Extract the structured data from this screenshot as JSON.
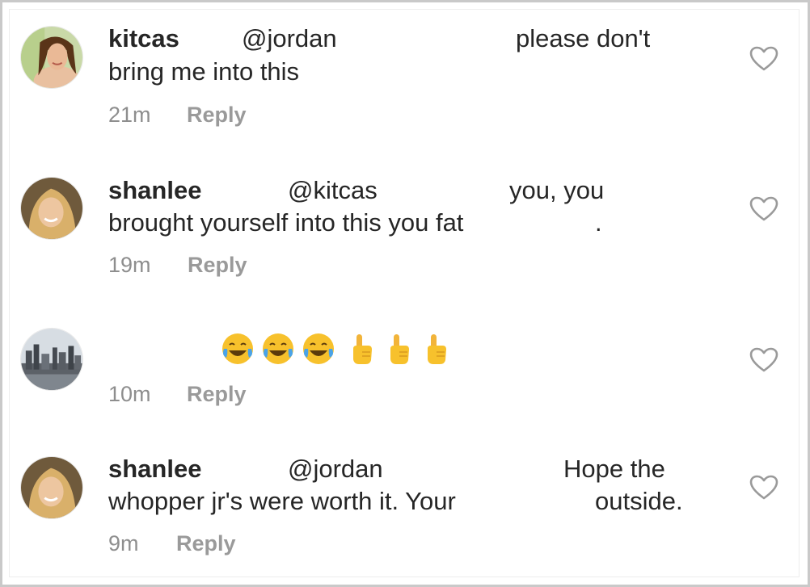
{
  "comments": [
    {
      "username": "kitcas",
      "mention": "@jordan",
      "text_line1_end": "please don't",
      "text_line2": "bring me into this",
      "time": "21m",
      "reply_label": "Reply",
      "avatar_icon": "profile-photo",
      "like_icon": "heart-outline"
    },
    {
      "username": "shanlee",
      "mention": "@kitcas",
      "text_line1_end": "you, you",
      "text_line2": "brought yourself into this you fat",
      "text_line2_end": ".",
      "time": "19m",
      "reply_label": "Reply",
      "avatar_icon": "profile-photo",
      "like_icon": "heart-outline"
    },
    {
      "emojis": [
        "face-with-tears-of-joy",
        "face-with-tears-of-joy",
        "face-with-tears-of-joy",
        "backhand-index-pointing-up",
        "backhand-index-pointing-up",
        "backhand-index-pointing-up"
      ],
      "time": "10m",
      "reply_label": "Reply",
      "avatar_icon": "city-skyline-photo",
      "like_icon": "heart-outline"
    },
    {
      "username": "shanlee",
      "mention": "@jordan",
      "text_line1_end": "Hope the",
      "text_line2": "whopper jr's were worth it. Your",
      "text_line2_end": "outside.",
      "time": "9m",
      "reply_label": "Reply",
      "avatar_icon": "profile-photo",
      "like_icon": "heart-outline"
    }
  ],
  "colors": {
    "text": "#262626",
    "meta": "#8e8e8e",
    "heart_stroke": "#9a9a9a",
    "emoji_yellow": "#f7c12c"
  }
}
